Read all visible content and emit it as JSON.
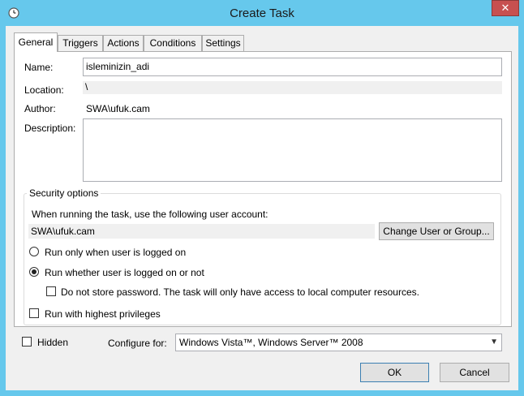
{
  "window": {
    "title": "Create Task"
  },
  "tabs": [
    "General",
    "Triggers",
    "Actions",
    "Conditions",
    "Settings"
  ],
  "general": {
    "name_label": "Name:",
    "name_value": "isleminizin_adi",
    "location_label": "Location:",
    "location_value": "\\",
    "author_label": "Author:",
    "author_value": "SWA\\ufuk.cam",
    "description_label": "Description:",
    "description_value": ""
  },
  "security": {
    "title": "Security options",
    "account_prompt": "When running the task, use the following user account:",
    "account_value": "SWA\\ufuk.cam",
    "change_button": "Change User or Group...",
    "radio_logged_on": "Run only when user is logged on",
    "radio_whether": "Run whether user is logged on or not",
    "do_not_store": "Do not store password.  The task will only have access to local computer resources.",
    "highest_privileges": "Run with highest privileges",
    "selected_radio": "whether"
  },
  "footer": {
    "hidden_label": "Hidden",
    "configure_label": "Configure for:",
    "configure_value": "Windows Vista™, Windows Server™ 2008",
    "ok_button": "OK",
    "cancel_button": "Cancel"
  }
}
